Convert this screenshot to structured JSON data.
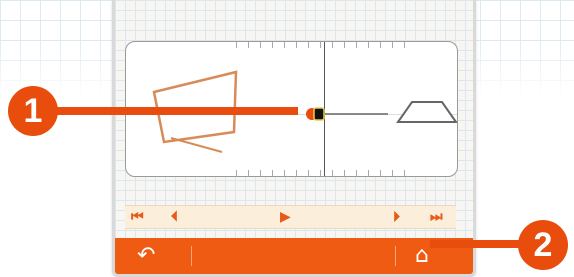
{
  "colors": {
    "accent": "#ef5b13",
    "callout": "#e84d0e",
    "shape_left": "#d78b59",
    "shape_right": "#666666"
  },
  "timeline": {
    "first_label": "⏮",
    "prev_label": "⏴",
    "play_label": "▶",
    "next_label": "⏵",
    "last_label": "⏭"
  },
  "bottombar": {
    "back_icon": "back-arrow-icon",
    "back_label": "↶",
    "stamp_icon": "stamp-icon",
    "stamp_label": "⌂"
  },
  "callouts": {
    "one": "1",
    "two": "2"
  }
}
